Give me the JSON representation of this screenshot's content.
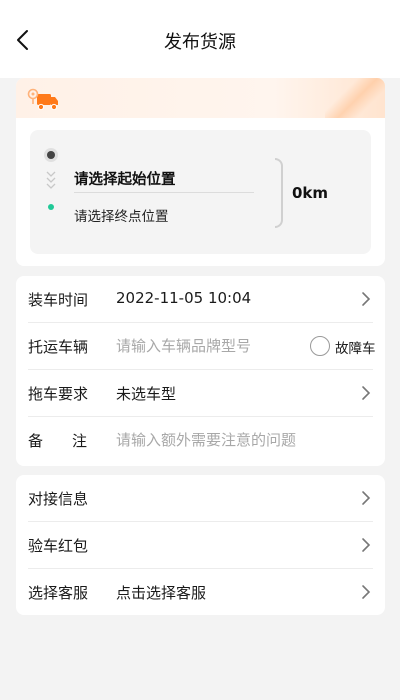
{
  "header": {
    "title": "发布货源",
    "back_icon": "chevron-left-icon"
  },
  "route": {
    "banner_icon": "truck-icon",
    "start_placeholder": "请选择起始位置",
    "end_placeholder": "请选择终点位置",
    "distance": "0km",
    "colors": {
      "end_dot": "#20c997",
      "accent": "#ff7a1a"
    }
  },
  "form": {
    "load_time": {
      "label": "装车时间",
      "value": "2022-11-05 10:04"
    },
    "vehicle": {
      "label": "托运车辆",
      "placeholder": "请输入车辆品牌型号",
      "fault_label": "故障车"
    },
    "tow_req": {
      "label": "拖车要求",
      "value": "未选车型"
    },
    "remark": {
      "label": "备注",
      "placeholder": "请输入额外需要注意的问题"
    }
  },
  "menu": {
    "contact": {
      "label": "对接信息"
    },
    "red_packet": {
      "label": "验车红包"
    },
    "service": {
      "label": "选择客服",
      "value": "点击选择客服"
    }
  }
}
